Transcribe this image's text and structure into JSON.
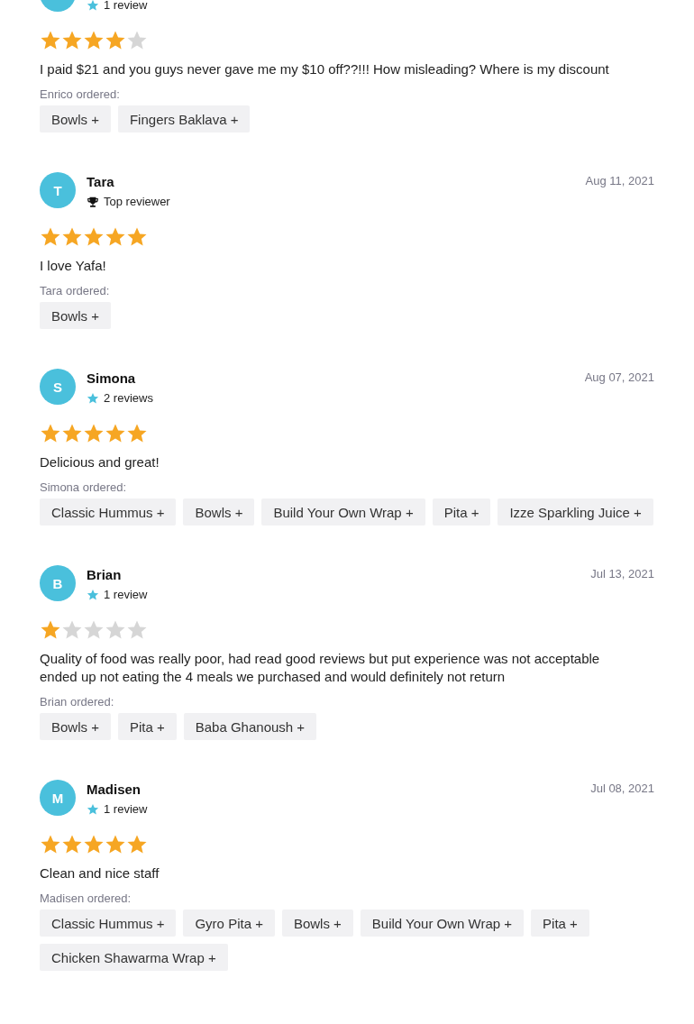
{
  "reviews": [
    {
      "badge": {
        "kind": "count",
        "text": "1 review"
      },
      "stars": 4,
      "text": "I paid $21 and you guys never gave me my $10 off??!!! How misleading? Where is my discount",
      "ordered_label": "Enrico ordered:",
      "items": [
        "Bowls +",
        "Fingers Baklava +"
      ]
    },
    {
      "initial": "T",
      "name": "Tara",
      "date": "Aug 11, 2021",
      "badge": {
        "kind": "top",
        "text": "Top reviewer"
      },
      "stars": 5,
      "text": "I love Yafa!",
      "ordered_label": "Tara ordered:",
      "items": [
        "Bowls +"
      ]
    },
    {
      "initial": "S",
      "name": "Simona",
      "date": "Aug 07, 2021",
      "badge": {
        "kind": "count",
        "text": "2 reviews"
      },
      "stars": 5,
      "text": "Delicious and great!",
      "ordered_label": "Simona ordered:",
      "items": [
        "Classic Hummus +",
        "Bowls +",
        "Build Your Own Wrap +",
        "Pita +",
        "Izze Sparkling Juice +"
      ]
    },
    {
      "initial": "B",
      "name": "Brian",
      "date": "Jul 13, 2021",
      "badge": {
        "kind": "count",
        "text": "1 review"
      },
      "stars": 1,
      "text": "Quality of food was really poor, had read good reviews but put experience was not acceptable ended up not eating the 4 meals we purchased and would definitely not return",
      "ordered_label": "Brian ordered:",
      "items": [
        "Bowls +",
        "Pita +",
        "Baba Ghanoush +"
      ]
    },
    {
      "initial": "M",
      "name": "Madisen",
      "date": "Jul 08, 2021",
      "badge": {
        "kind": "count",
        "text": "1 review"
      },
      "stars": 5,
      "text": "Clean and nice staff",
      "ordered_label": "Madisen ordered:",
      "items": [
        "Classic Hummus +",
        "Gyro Pita +",
        "Bowls +",
        "Build Your Own Wrap +",
        "Pita +",
        "Chicken Shawarma Wrap +"
      ]
    }
  ]
}
